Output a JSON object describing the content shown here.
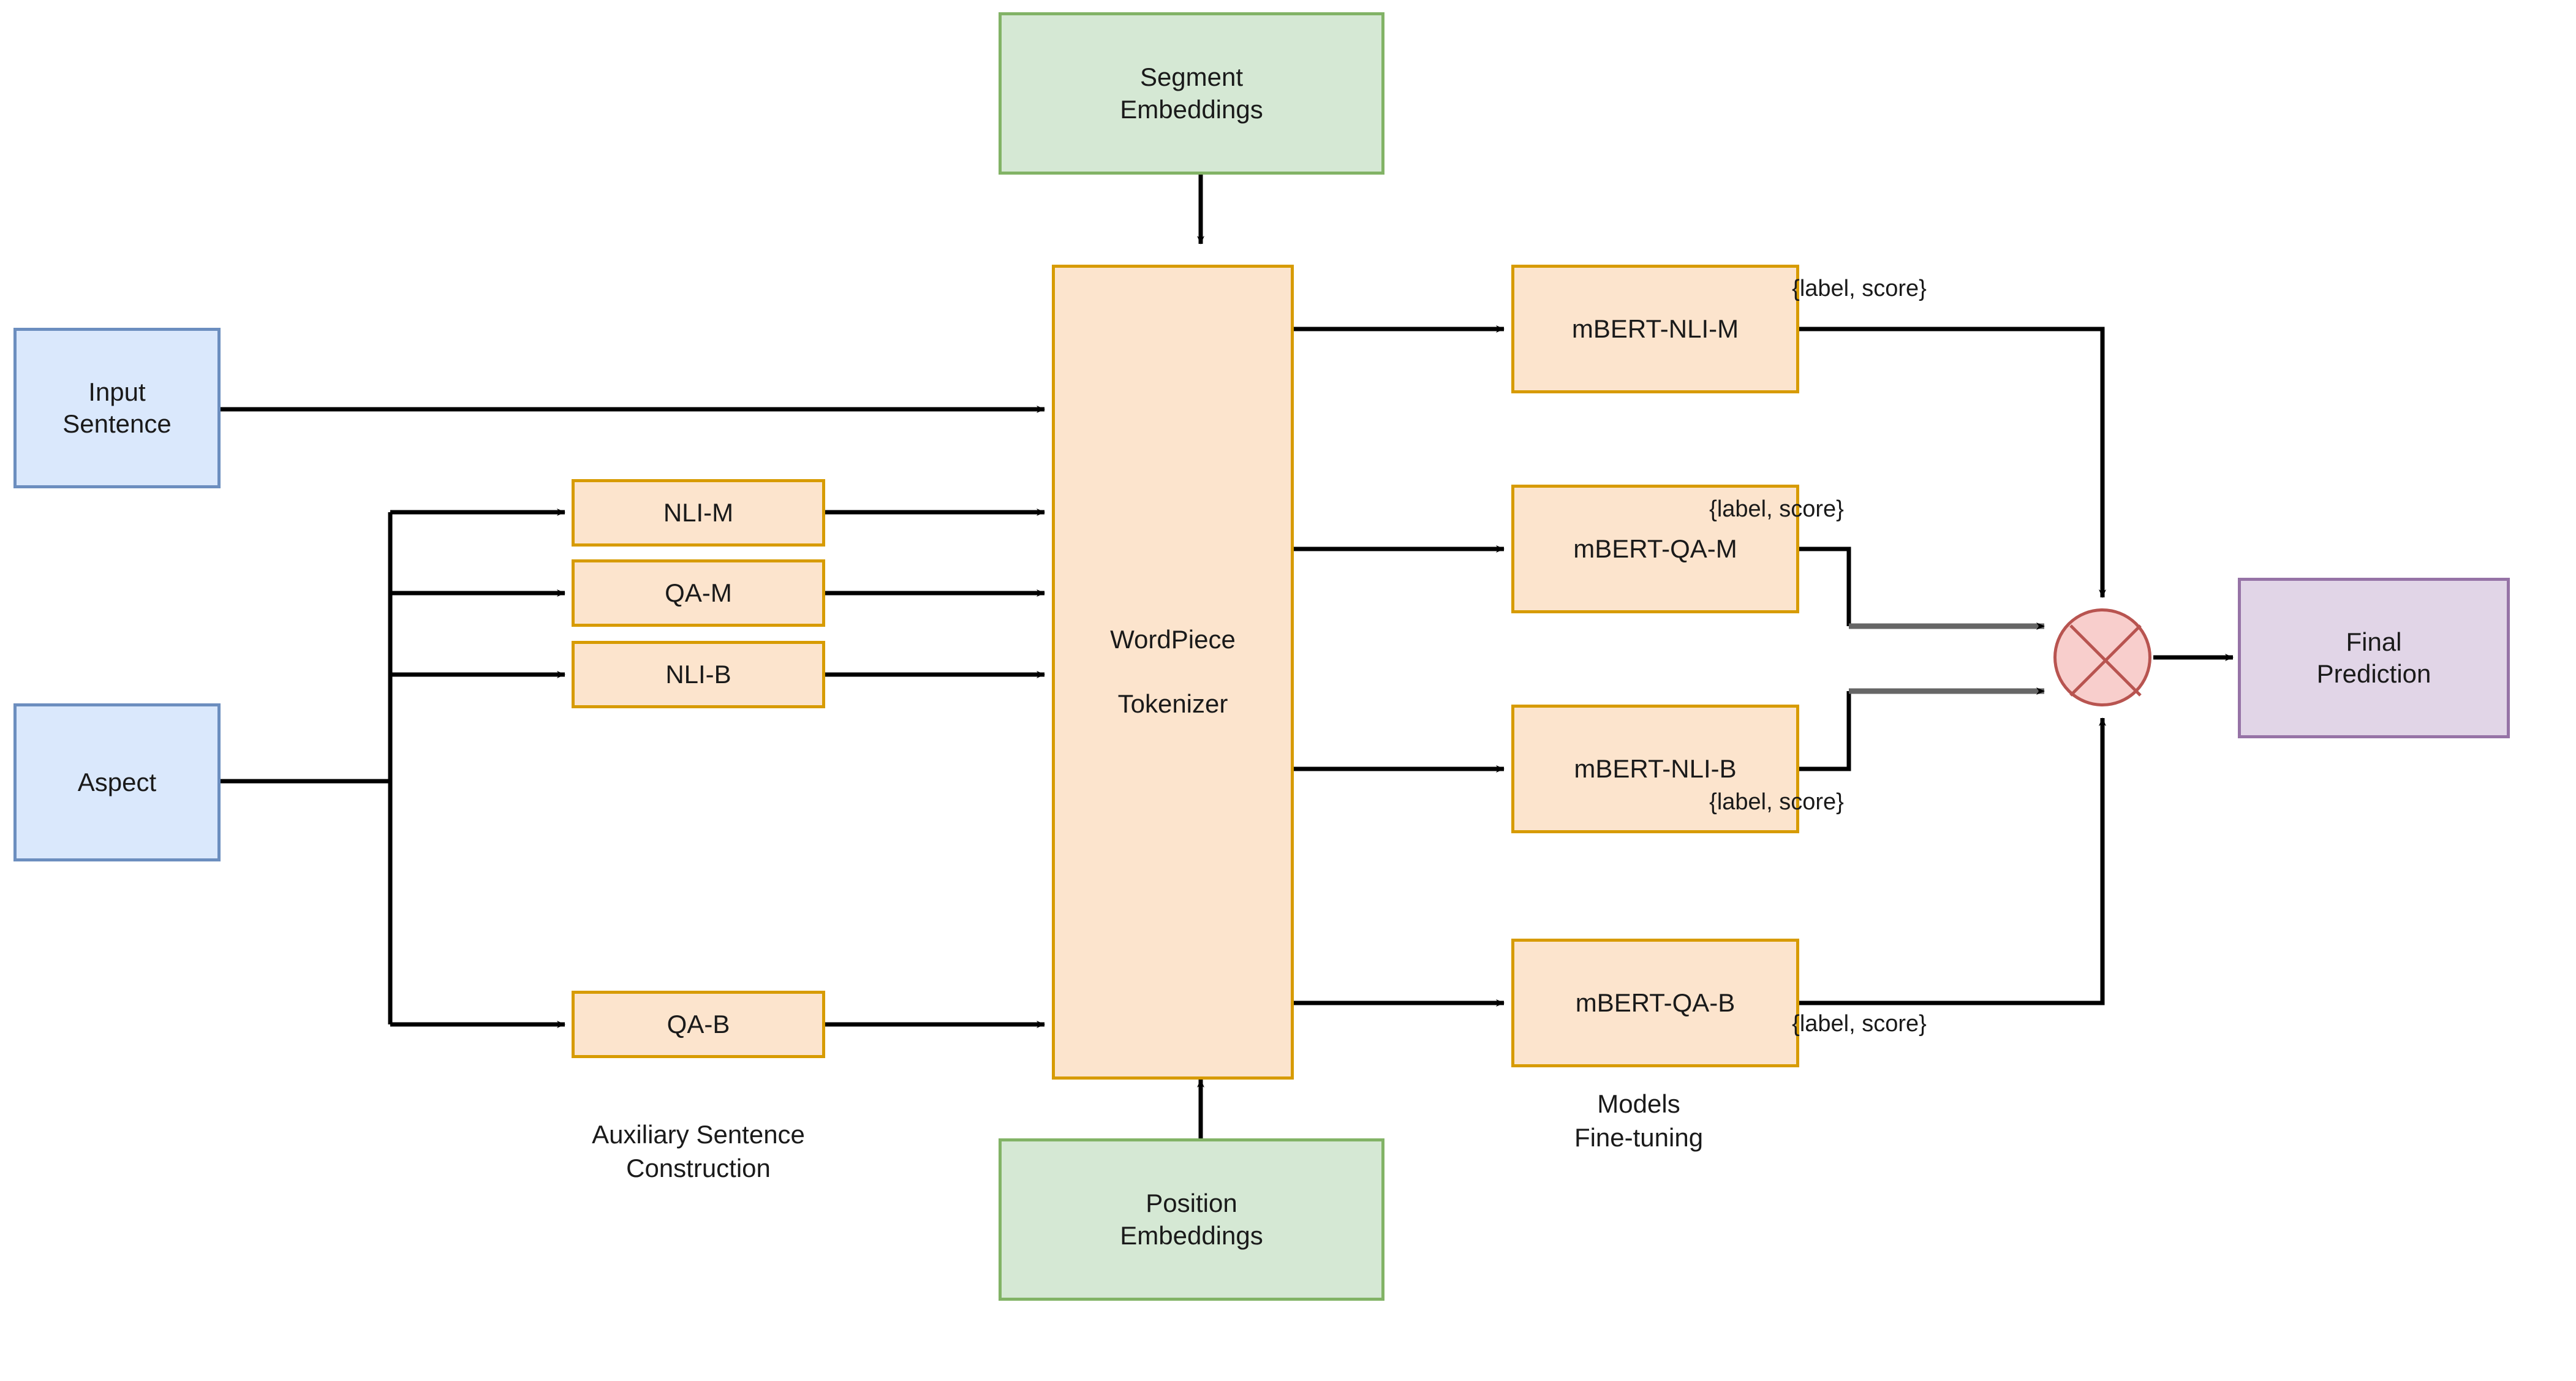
{
  "diagram": {
    "title": "Auxiliary sentence construction and mBERT fine-tuning pipeline",
    "colors": {
      "input_fill": "#DAE8FC",
      "input_stroke": "#6C8EBF",
      "embedding_fill": "#D5E8D4",
      "embedding_stroke": "#82B366",
      "process_fill": "#FCE4CD",
      "process_stroke": "#D79B00",
      "output_fill": "#E1D5E7",
      "output_stroke": "#9673A6",
      "merge_fill": "#F8CECC",
      "merge_stroke": "#B85450",
      "edge": "#000000",
      "edge_gray": "#666666"
    }
  },
  "inputs": {
    "sentence": "Input\nSentence",
    "aspect": "Aspect"
  },
  "embeddings": {
    "segment": "Segment\nEmbeddings",
    "position": "Position\nEmbeddings"
  },
  "auxiliary": {
    "caption": "Auxiliary Sentence\nConstruction",
    "items": [
      {
        "label": "NLI-M"
      },
      {
        "label": "QA-M"
      },
      {
        "label": "NLI-B"
      },
      {
        "label": "QA-B"
      }
    ]
  },
  "tokenizer": {
    "label": "WordPiece\n\nTokenizer"
  },
  "models": {
    "caption": "Models\nFine-tuning",
    "items": [
      {
        "label": "mBERT-NLI-M",
        "edge_label": "{label, score}"
      },
      {
        "label": "mBERT-QA-M",
        "edge_label": "{label, score}"
      },
      {
        "label": "mBERT-NLI-B",
        "edge_label": "{label, score}"
      },
      {
        "label": "mBERT-QA-B",
        "edge_label": "{label, score}"
      }
    ]
  },
  "merge": {
    "icon": "cross-circle-merge"
  },
  "output": {
    "label": "Final\nPrediction"
  }
}
